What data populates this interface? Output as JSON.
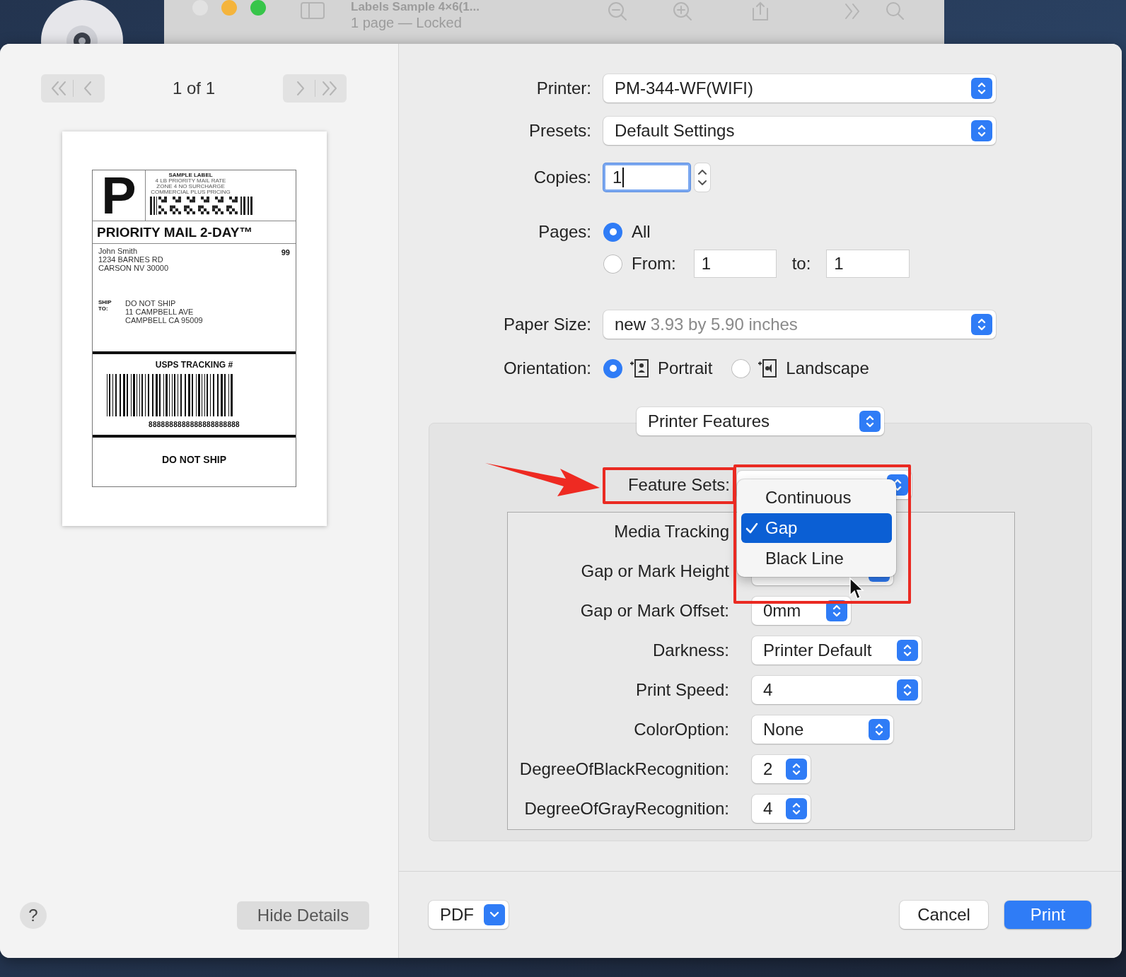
{
  "window": {
    "title": "Labels Sample 4×6(1...",
    "subtitle": "1 page — Locked"
  },
  "preview": {
    "page_indicator": "1 of 1",
    "label": {
      "class_letter": "P",
      "header_lines": [
        "SAMPLE LABEL",
        "4 LB PRIORITY MAIL RATE",
        "ZONE 4 NO SURCHARGE",
        "COMMERCIAL PLUS PRICING"
      ],
      "service": "PRIORITY MAIL 2-DAY™",
      "sender": [
        "John Smith",
        "1234 BARNES RD",
        "CARSON NV 30000"
      ],
      "code": "99",
      "ship_to_label": "SHIP TO:",
      "recipient": [
        "DO NOT SHIP",
        "11 CAMPBELL AVE",
        "CAMPBELL CA 95009"
      ],
      "tracking_title": "USPS TRACKING #",
      "tracking_number": "8888888888888888888888",
      "footer": "DO NOT SHIP"
    },
    "help": "?",
    "hide_details": "Hide Details"
  },
  "printer": {
    "label": "Printer:",
    "value": "PM-344-WF(WIFI)"
  },
  "presets": {
    "label": "Presets:",
    "value": "Default Settings"
  },
  "copies": {
    "label": "Copies:",
    "value": "1"
  },
  "pages": {
    "label": "Pages:",
    "options": [
      {
        "kind": "all",
        "label": "All",
        "selected": true
      },
      {
        "kind": "range",
        "label": "From:",
        "selected": false,
        "from": "1",
        "to_label": "to:",
        "to": "1"
      }
    ]
  },
  "paper_size": {
    "label": "Paper Size:",
    "name": "new",
    "value": "3.93 by 5.90 inches"
  },
  "orientation": {
    "label": "Orientation:",
    "options": [
      {
        "kind": "portrait",
        "label": "Portrait",
        "selected": true
      },
      {
        "kind": "landscape",
        "label": "Landscape",
        "selected": false
      }
    ]
  },
  "section": {
    "value": "Printer Features"
  },
  "feature_sets": {
    "label": "Feature Sets:"
  },
  "features": [
    {
      "label": "Media Tracking",
      "kind": "medium"
    },
    {
      "label": "Gap or Mark Height",
      "kind": "medium"
    },
    {
      "label": "Gap or Mark Offset:",
      "value": "0mm",
      "kind": "short"
    },
    {
      "label": "Darkness:",
      "value": "Printer Default",
      "kind": "long"
    },
    {
      "label": "Print Speed:",
      "value": "4",
      "kind": "long"
    },
    {
      "label": "ColorOption:",
      "value": "None",
      "kind": "medium"
    },
    {
      "label": "DegreeOfBlackRecognition:",
      "value": "2",
      "kind": "tiny"
    },
    {
      "label": "DegreeOfGrayRecognition:",
      "value": "4",
      "kind": "tiny"
    }
  ],
  "menu": {
    "items": [
      {
        "label": "Continuous",
        "selected": false
      },
      {
        "label": "Gap",
        "selected": true
      },
      {
        "label": "Black Line",
        "selected": false
      }
    ]
  },
  "footer": {
    "pdf": "PDF",
    "cancel": "Cancel",
    "print": "Print"
  }
}
